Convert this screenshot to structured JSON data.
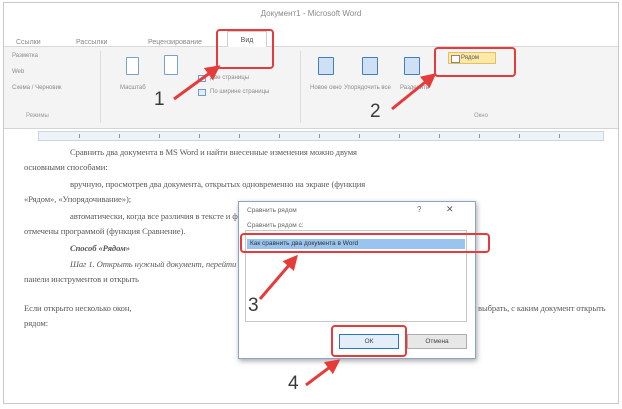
{
  "window": {
    "title": "Документ1 - Microsoft Word"
  },
  "tabs": [
    "Ссылки",
    "Рассылки",
    "Рецензирование"
  ],
  "active_tab": "Вид",
  "ribbon": {
    "left_items": [
      "Разметка",
      "Web",
      "Схема / Черновик"
    ],
    "left_group": "Режимы",
    "zoom_label": "Масштаб",
    "window_items": [
      "Новое окно",
      "Упорядочить все",
      "Разделить"
    ],
    "side_by_side": "Рядом",
    "window_group": "Окно",
    "two_pages": "Две страницы",
    "page_width": "По ширине страницы"
  },
  "document": {
    "lines": [
      "Сравнить два документа в MS Word и найти внесенные изменения можно двумя",
      "основными способами:",
      "вручную, просмотрев два документа, открытых одновременно на экране (функция",
      "«Рядом», «Упорядочивание»);",
      "автоматически, когда все различия в тексте и форматировании, будут",
      "отмечены программой (функция Сравнение).",
      "Способ «Рядом»",
      "Шаг 1. Открыть нужный документ, перейти во вкладку меню «Вид» на",
      "панели инструментов и открыть",
      "Если открыто несколько окон,",
      "выбрать, с каким документ открыть",
      "рядом:"
    ]
  },
  "dialog": {
    "title": "Сравнить рядом",
    "help": "?",
    "close": "✕",
    "label": "Сравнить рядом с:",
    "item": "Как сравнить два документа в Word",
    "ok": "ОК",
    "cancel": "Отмена"
  },
  "steps": [
    "1",
    "2",
    "3",
    "4"
  ],
  "colors": {
    "highlight": "#e53b3b",
    "selection": "#99c4ef"
  }
}
